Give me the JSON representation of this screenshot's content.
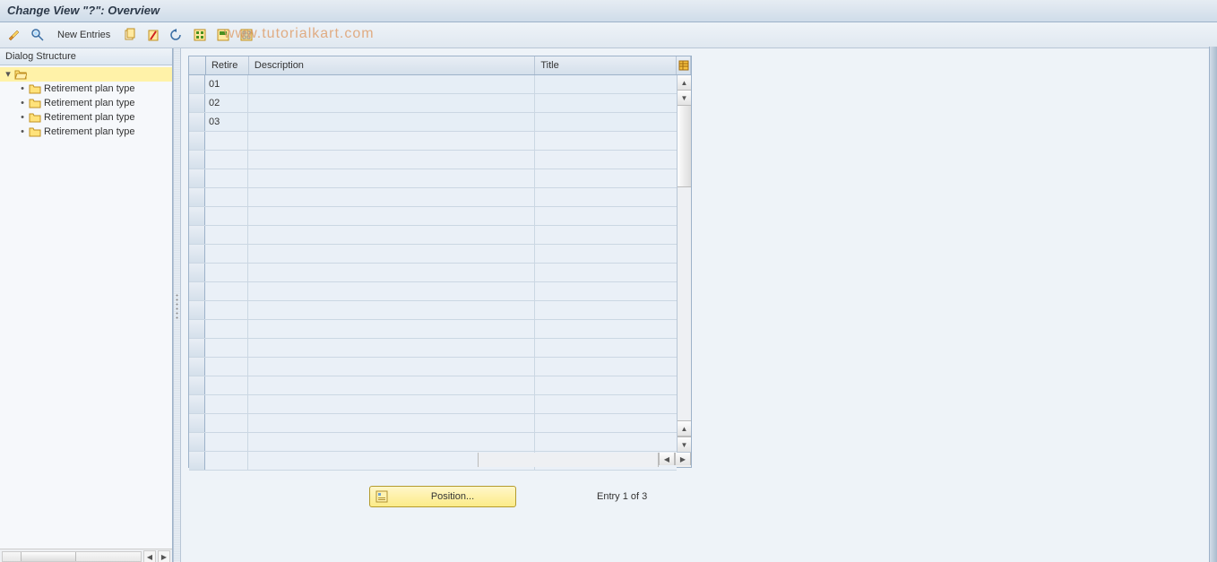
{
  "title": "Change View \"?\": Overview",
  "toolbar": {
    "new_entries": "New Entries"
  },
  "watermark": "www.tutorialkart.com",
  "sidebar": {
    "header": "Dialog Structure",
    "root_label": "",
    "items": [
      {
        "label": "Retirement plan type"
      },
      {
        "label": "Retirement plan type"
      },
      {
        "label": "Retirement plan type"
      },
      {
        "label": "Retirement plan type"
      }
    ]
  },
  "grid": {
    "columns": {
      "retire": "Retire",
      "description": "Description",
      "title": "Title"
    },
    "rows": [
      {
        "retire": "01",
        "description": "",
        "title": ""
      },
      {
        "retire": "02",
        "description": "",
        "title": ""
      },
      {
        "retire": "03",
        "description": "",
        "title": ""
      }
    ],
    "empty_row_count": 18
  },
  "footer": {
    "position_button": "Position...",
    "entry_text": "Entry 1 of 3"
  }
}
